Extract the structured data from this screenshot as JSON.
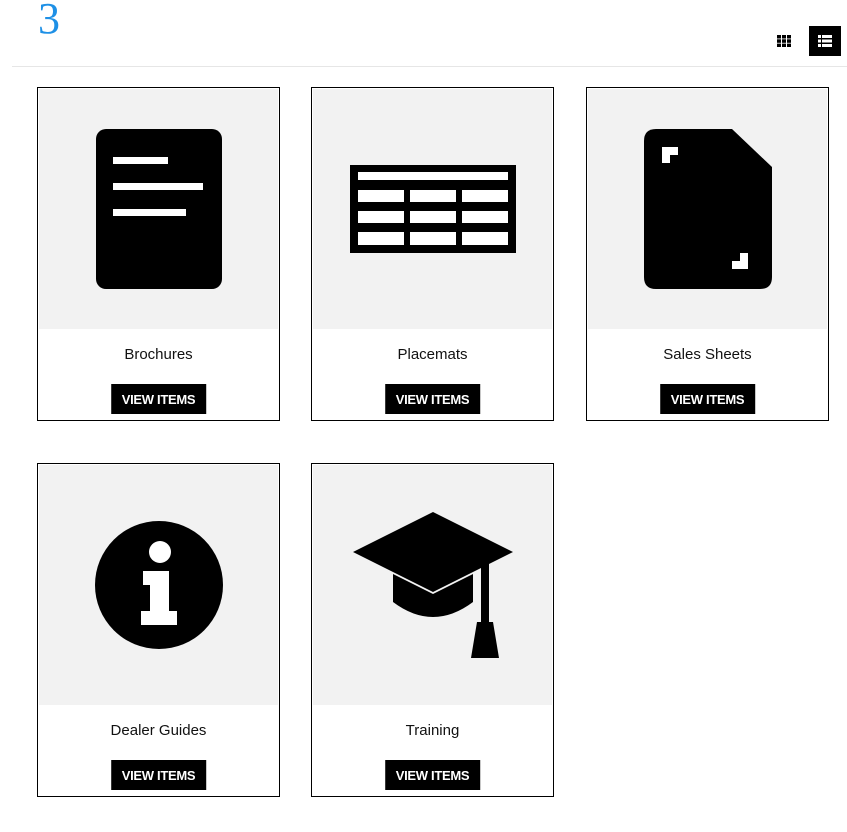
{
  "header": {
    "count": "3",
    "grid_view_icon": "grid-view-icon",
    "list_view_icon": "list-view-icon"
  },
  "categories": [
    {
      "title": "Brochures",
      "button": "VIEW ITEMS",
      "icon": "document-icon"
    },
    {
      "title": "Placemats",
      "button": "VIEW ITEMS",
      "icon": "table-icon"
    },
    {
      "title": "Sales Sheets",
      "button": "VIEW ITEMS",
      "icon": "sheet-icon"
    },
    {
      "title": "Dealer Guides",
      "button": "VIEW ITEMS",
      "icon": "info-icon"
    },
    {
      "title": "Training",
      "button": "VIEW ITEMS",
      "icon": "graduation-cap-icon"
    }
  ],
  "colors": {
    "accent": "#1e90e6",
    "button_bg": "#000000",
    "image_bg": "#f2f2f2"
  }
}
